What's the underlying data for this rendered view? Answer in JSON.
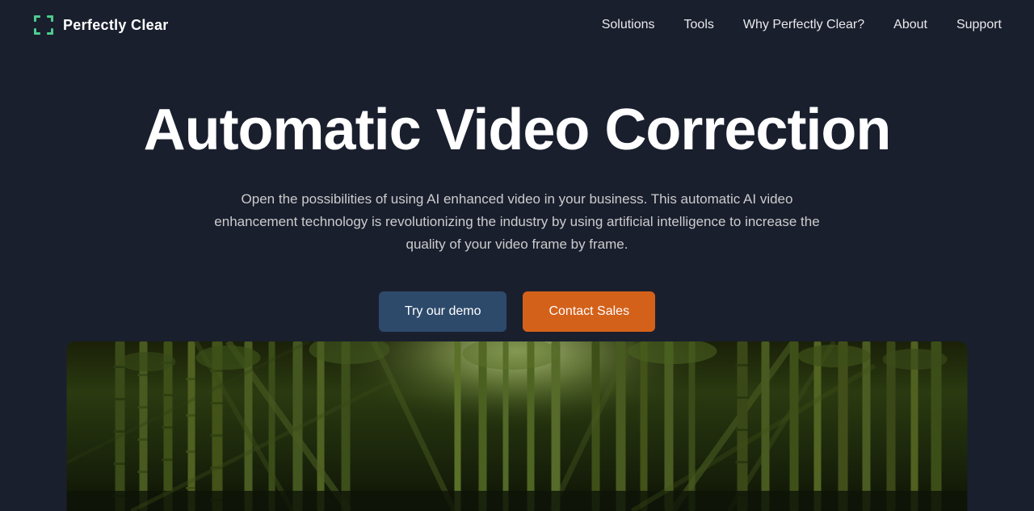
{
  "logo": {
    "text": "Perfectly Clear",
    "icon_name": "logo-icon"
  },
  "nav": {
    "links": [
      {
        "label": "Solutions",
        "id": "solutions"
      },
      {
        "label": "Tools",
        "id": "tools"
      },
      {
        "label": "Why Perfectly Clear?",
        "id": "why"
      },
      {
        "label": "About",
        "id": "about"
      },
      {
        "label": "Support",
        "id": "support"
      }
    ]
  },
  "hero": {
    "title": "Automatic Video Correction",
    "subtitle": "Open the possibilities of using AI enhanced video in your business. This automatic AI video enhancement technology is revolutionizing the industry by using artificial intelligence to increase the quality of your video frame by frame.",
    "btn_demo": "Try our demo",
    "btn_contact": "Contact Sales"
  }
}
